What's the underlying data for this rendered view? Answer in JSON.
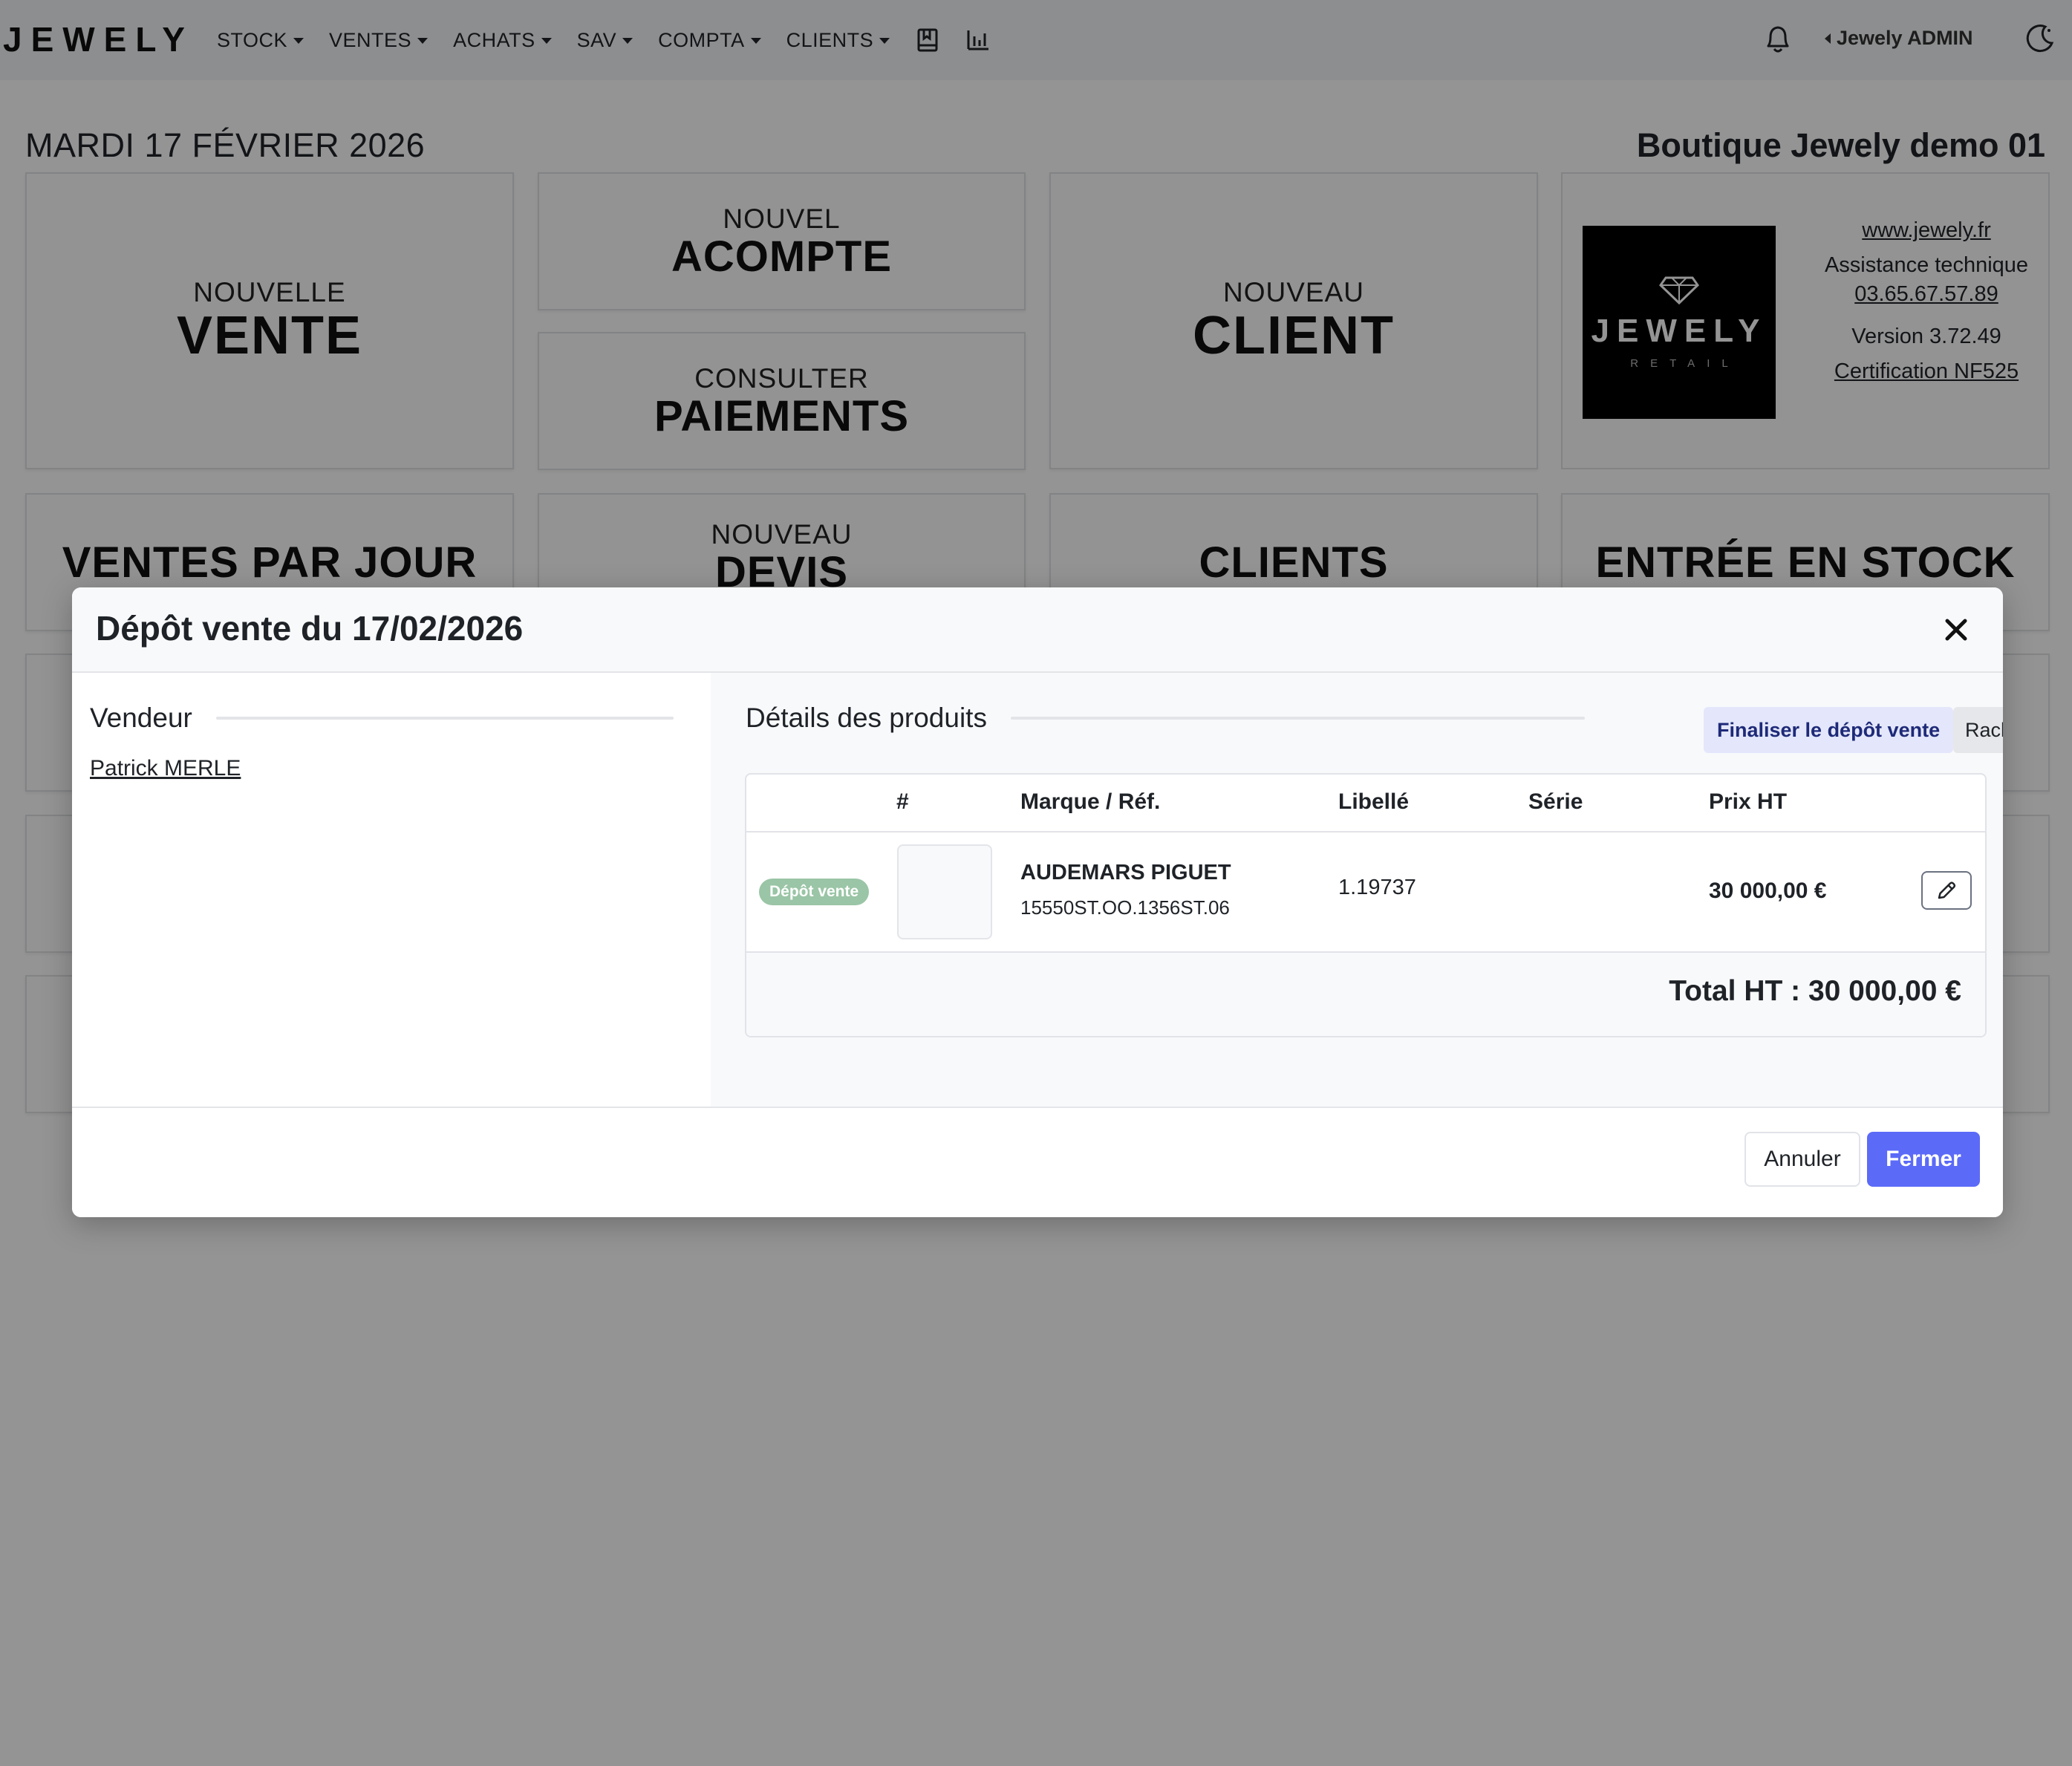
{
  "nav": {
    "logo": "JEWELY",
    "menu": [
      {
        "label": "STOCK"
      },
      {
        "label": "VENTES"
      },
      {
        "label": "ACHATS"
      },
      {
        "label": "SAV"
      },
      {
        "label": "COMPTA"
      },
      {
        "label": "CLIENTS"
      }
    ],
    "icons": [
      "bookmark-book-icon",
      "bar-chart-icon"
    ],
    "user": "Jewely ADMIN",
    "right_icons": [
      "bell-icon",
      "moon-sun-icon"
    ]
  },
  "dashboard": {
    "date": "MARDI 17 FÉVRIER 2026",
    "shop": "Boutique Jewely demo 01",
    "tiles": {
      "vente": {
        "small": "NOUVELLE",
        "big": "VENTE"
      },
      "acompte": {
        "small": "NOUVEL",
        "big": "ACOMPTE"
      },
      "paiements": {
        "small": "CONSULTER",
        "big": "PAIEMENTS"
      },
      "client": {
        "small": "NOUVEAU",
        "big": "CLIENT"
      },
      "ventes_jour": {
        "big": "VENTES PAR JOUR"
      },
      "devis": {
        "small": "NOUVEAU",
        "big": "DEVIS"
      },
      "clients": {
        "big": "CLIENTS"
      },
      "stock": {
        "big": "ENTRÉE EN STOCK"
      }
    },
    "info": {
      "logo_text": "JEWELY",
      "logo_sub": "RETAIL",
      "website": "www.jewely.fr",
      "support_label": "Assistance technique",
      "phone": "03.65.67.57.89",
      "version": "Version 3.72.49",
      "certification": "Certification NF525"
    }
  },
  "modal": {
    "title": "Dépôt vente du 17/02/2026",
    "vendeur_label": "Vendeur",
    "vendeur_name": "Patrick MERLE",
    "details_label": "Détails des produits",
    "finaliser_label": "Finaliser le dépôt vente",
    "racheter_label": "Racheter",
    "columns": [
      "#",
      "Marque / Réf.",
      "Libellé",
      "Série",
      "Prix HT"
    ],
    "rows": [
      {
        "badge": "Dépôt vente",
        "brand": "AUDEMARS PIGUET",
        "ref": "15550ST.OO.1356ST.06",
        "libelle": "1.19737",
        "serie": "",
        "prix": "30 000,00 €"
      }
    ],
    "total": "Total HT : 30 000,00 €",
    "annuler_label": "Annuler",
    "fermer_label": "Fermer"
  }
}
